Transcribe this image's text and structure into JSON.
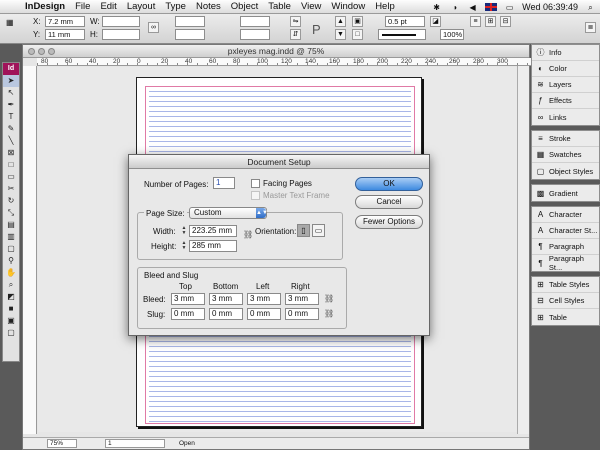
{
  "menubar": {
    "app": "InDesign",
    "items": [
      "File",
      "Edit",
      "Layout",
      "Type",
      "Notes",
      "Object",
      "Table",
      "View",
      "Window",
      "Help"
    ],
    "clock": "Wed 06:39:49"
  },
  "control": {
    "x_label": "X:",
    "x_value": "7.2 mm",
    "y_label": "Y:",
    "y_value": "11 mm",
    "w_label": "W:",
    "h_label": "H:",
    "stroke_weight": "0.5 pt",
    "opacity": "100%"
  },
  "document": {
    "title": "pxleyes mag.indd @ 75%",
    "ruler_numbers": [
      "80",
      "60",
      "40",
      "20",
      "0",
      "20",
      "40",
      "60",
      "80",
      "100",
      "120",
      "140",
      "160",
      "180",
      "200",
      "220",
      "240",
      "260",
      "280",
      "300"
    ],
    "zoom": "75%",
    "page": "1",
    "status": "Open"
  },
  "panels": {
    "group1": [
      {
        "label": "Info",
        "icon": "info-icon"
      },
      {
        "label": "Color",
        "icon": "color-icon"
      },
      {
        "label": "Layers",
        "icon": "layers-icon"
      },
      {
        "label": "Effects",
        "icon": "effects-icon"
      },
      {
        "label": "Links",
        "icon": "links-icon"
      }
    ],
    "group2": [
      {
        "label": "Stroke",
        "icon": "stroke-icon"
      },
      {
        "label": "Swatches",
        "icon": "swatches-icon"
      },
      {
        "label": "Object Styles",
        "icon": "object-styles-icon"
      }
    ],
    "group3": [
      {
        "label": "Gradient",
        "icon": "gradient-icon"
      }
    ],
    "group4": [
      {
        "label": "Character",
        "icon": "character-icon"
      },
      {
        "label": "Character St...",
        "icon": "character-styles-icon"
      },
      {
        "label": "Paragraph",
        "icon": "paragraph-icon"
      },
      {
        "label": "Paragraph St...",
        "icon": "paragraph-styles-icon"
      }
    ],
    "group5": [
      {
        "label": "Table Styles",
        "icon": "table-styles-icon"
      },
      {
        "label": "Cell Styles",
        "icon": "cell-styles-icon"
      },
      {
        "label": "Table",
        "icon": "table-icon"
      }
    ]
  },
  "dialog": {
    "title": "Document Setup",
    "num_pages_label": "Number of Pages:",
    "num_pages": "1",
    "facing_pages": "Facing Pages",
    "master_text_frame": "Master Text Frame",
    "page_size_label": "Page Size:",
    "page_size": "Custom",
    "width_label": "Width:",
    "width": "223.25 mm",
    "height_label": "Height:",
    "height": "285 mm",
    "orientation_label": "Orientation:",
    "bleed_slug_title": "Bleed and Slug",
    "col_top": "Top",
    "col_bottom": "Bottom",
    "col_left": "Left",
    "col_right": "Right",
    "bleed_label": "Bleed:",
    "slug_label": "Slug:",
    "bleed": {
      "top": "3 mm",
      "bottom": "3 mm",
      "left": "3 mm",
      "right": "3 mm"
    },
    "slug": {
      "top": "0 mm",
      "bottom": "0 mm",
      "left": "0 mm",
      "right": "0 mm"
    },
    "ok": "OK",
    "cancel": "Cancel",
    "fewer_options": "Fewer Options"
  },
  "colors": {
    "accent_button": "#3e8ae0",
    "page_guide": "#e07aa6",
    "baseline_grid": "#8c9ee0",
    "indesign_logo": "#a0135a"
  }
}
